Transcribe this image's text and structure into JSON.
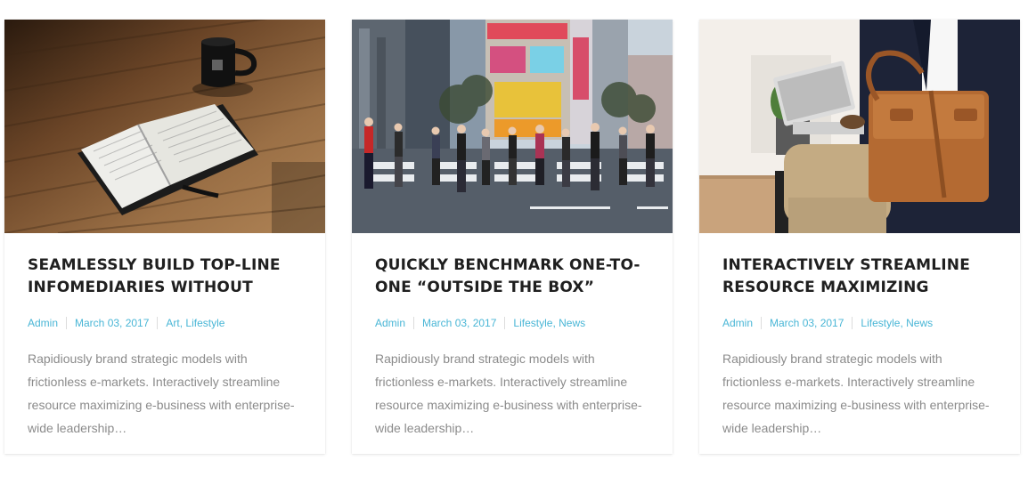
{
  "posts": [
    {
      "image": "open-book-and-mug-on-wooden-table",
      "title": "SEAMLESSLY BUILD TOP-LINE INFOMEDIARIES WITHOUT",
      "author": "Admin",
      "date": "March 03, 2017",
      "categories": [
        "Art",
        "Lifestyle"
      ],
      "excerpt": "Rapidiously brand strategic models with frictionless e-markets. Interactively streamline resource maximizing e-business with enterprise-wide leadership…"
    },
    {
      "image": "city-crosswalk-crowd",
      "title": "QUICKLY BENCHMARK ONE-TO-ONE “OUTSIDE THE BOX”",
      "author": "Admin",
      "date": "March 03, 2017",
      "categories": [
        "Lifestyle",
        "News"
      ],
      "excerpt": "Rapidiously brand strategic models with frictionless e-markets. Interactively streamline resource maximizing e-business with enterprise-wide leadership…"
    },
    {
      "image": "man-with-laptop-and-leather-bag",
      "title": "INTERACTIVELY STREAMLINE RESOURCE MAXIMIZING",
      "author": "Admin",
      "date": "March 03, 2017",
      "categories": [
        "Lifestyle",
        "News"
      ],
      "excerpt": "Rapidiously brand strategic models with frictionless e-markets. Interactively streamline resource maximizing e-business with enterprise-wide leadership…"
    }
  ],
  "colors": {
    "accent": "#49b6d6",
    "title": "#1f1f1f",
    "text": "#8b8b8b"
  }
}
